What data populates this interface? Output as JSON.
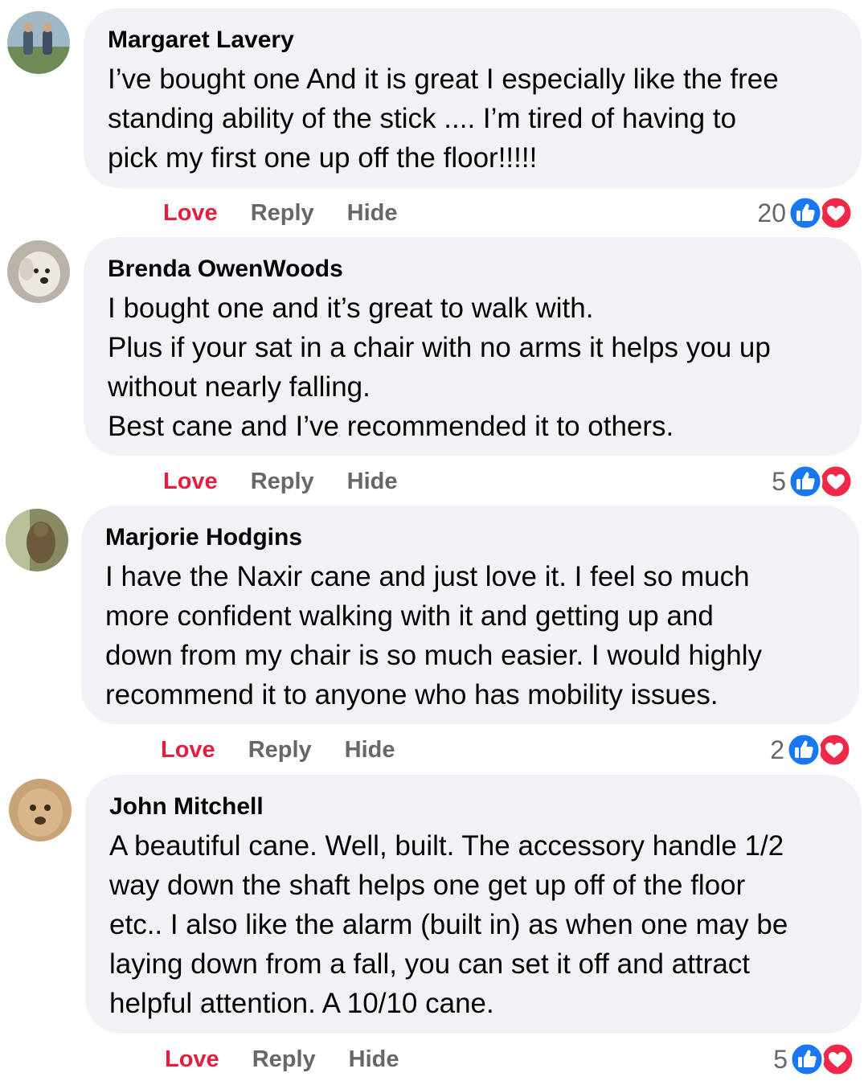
{
  "actions": {
    "love_label": "Love",
    "reply_label": "Reply",
    "hide_label": "Hide"
  },
  "colors": {
    "love_red": "#e41e3f",
    "muted_gray": "#65676b",
    "bubble_bg": "#f0f2f5",
    "like_blue": "#1877f2",
    "love_react_red": "#f0284a"
  },
  "comments": [
    {
      "author": "Margaret Lavery",
      "lines": [
        "I’ve bought one And it is great I especially like the free",
        "standing ability of the stick .... I’m tired of having to",
        "pick my first one up off the floor!!!!!"
      ],
      "reaction_count": "20",
      "reaction_icons": [
        "like-icon",
        "love-icon"
      ]
    },
    {
      "author": "Brenda OwenWoods",
      "lines": [
        "I bought one and it’s great to walk with.",
        "Plus if your sat in a chair with no arms it helps you up",
        "without nearly falling.",
        "Best cane and I’ve recommended it to others."
      ],
      "reaction_count": "5",
      "reaction_icons": [
        "like-icon",
        "love-icon"
      ]
    },
    {
      "author": "Marjorie Hodgins",
      "lines": [
        "I have the Naxir cane and just love it. I feel so much",
        "more confident walking with it and getting up and",
        "down from my chair is so much easier. I would highly",
        "recommend it to anyone who has mobility issues."
      ],
      "reaction_count": "2",
      "reaction_icons": [
        "like-icon",
        "love-icon"
      ]
    },
    {
      "author": "John Mitchell",
      "lines": [
        "A beautiful cane. Well, built. The accessory handle 1/2",
        "way down the shaft helps one get up off of the floor",
        "etc.. I also like the alarm (built in) as when one may be",
        "laying down from a fall, you can set it off and attract",
        "helpful attention. A 10/10 cane."
      ],
      "reaction_count": "5",
      "reaction_icons": [
        "like-icon",
        "love-icon"
      ]
    }
  ]
}
